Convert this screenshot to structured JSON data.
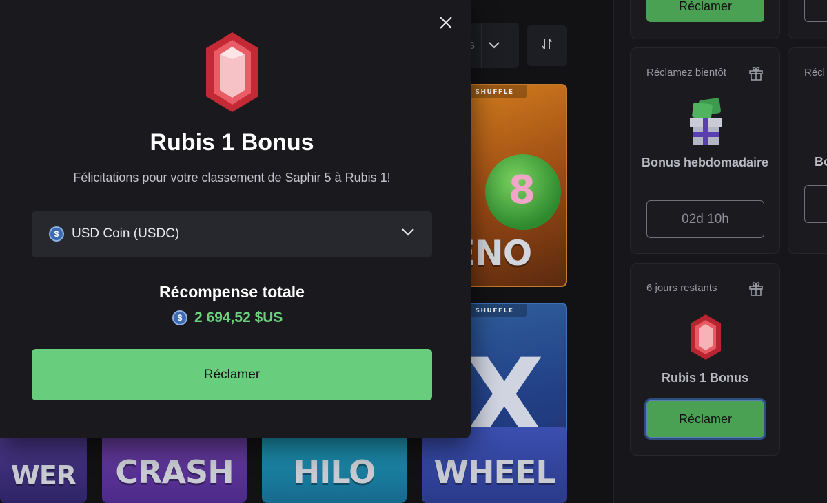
{
  "background": {
    "sort_select_fragment": "s",
    "games": [
      {
        "title": "KENO",
        "tag": "SHUFFLE",
        "ball_number": "8"
      },
      {
        "title": "",
        "tag": "SHUFFLE",
        "mark": "X"
      },
      {
        "title": "CRASH"
      },
      {
        "title": "HILO"
      },
      {
        "title": "WHEEL"
      },
      {
        "title": "WER"
      }
    ]
  },
  "sidebar": {
    "top_button_label": "Réclamer",
    "weekly": {
      "header": "Réclamez bientôt",
      "name": "Bonus hebdomadaire",
      "countdown": "02d 10h"
    },
    "next_card": {
      "header": "Récl",
      "name": "Bo"
    },
    "rubis": {
      "header": "6 jours restants",
      "name": "Rubis 1 Bonus",
      "button_label": "Réclamer"
    }
  },
  "modal": {
    "title": "Rubis 1 Bonus",
    "subtitle": "Félicitations pour votre classement de Saphir 5 à Rubis 1!",
    "currency": "USD Coin (USDC)",
    "reward_title": "Récompense totale",
    "reward_amount": "2 694,52 $US",
    "claim_label": "Réclamer",
    "close_icon": "×",
    "coin_symbol": "$"
  },
  "colors": {
    "accent_green": "#68cd7c",
    "reward_green": "#6cd07e",
    "ruby_red": "#e2444e",
    "modal_bg": "#1a1a1e"
  }
}
